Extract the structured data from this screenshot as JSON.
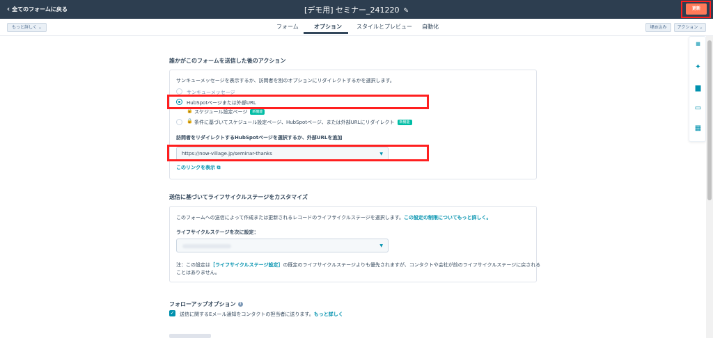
{
  "header": {
    "back_label": "全てのフォームに戻る",
    "form_title": "[デモ用] セミナー_241220",
    "update_label": "更新"
  },
  "subheader": {
    "more_label": "もっと詳しく ⌄",
    "tabs": [
      {
        "label": "フォーム"
      },
      {
        "label": "オプション"
      },
      {
        "label": "スタイルとプレビュー"
      },
      {
        "label": "自動化"
      }
    ],
    "embed_label": "埋め込み",
    "actions_label": "アクション ⌄"
  },
  "section_after_submit": {
    "title": "誰かがこのフォームを送信した後のアクション",
    "description": "サンキューメッセージを表示するか、訪問者を別のオプションにリダイレクトするかを選択します。",
    "options": [
      {
        "label": "サンキューメッセージ",
        "checked": false
      },
      {
        "label": "HubSpotページまたは外部URL",
        "checked": true
      },
      {
        "label": "スケジュール設定ページ",
        "checked": false,
        "badge": "新機能"
      },
      {
        "label": "条件に基づいてスケジュール設定ページ、HubSpotページ、または外部URLにリダイレクト",
        "checked": false,
        "badge": "新機能"
      }
    ],
    "redirect_label": "訪問者をリダイレクトするHubSpotページを選択するか、外部URLを追加",
    "redirect_value": "https://now-village.jp/seminar-thanks",
    "show_link": "このリンクを表示"
  },
  "section_lifecycle": {
    "title": "送信に基づいてライフサイクルステージをカスタマイズ",
    "description": "このフォームへの送信によって作成または更新されるレコードのライフサイクルステージを選択します。",
    "description_link": "この設定の制限についてもっと詳しく。",
    "field_label": "ライフサイクルステージを次に設定：",
    "note_prefix": "注：この設定は",
    "note_link": "［ライフサイクルステージ設定］",
    "note_suffix": "の既定のライフサイクルステージよりも優先されますが、コンタクトや会社が前のライフサイクルステージに戻される",
    "note_line2": "ことはありません。"
  },
  "section_followup": {
    "title": "フォローアップオプション",
    "checkbox_label": "送信に関するEメール通知をコンタクトの担当者に送ります。",
    "checkbox_link": "もっと詳しく",
    "checked": true
  },
  "colors": {
    "header_bg": "#2d3e50",
    "accent": "#0091ae",
    "update_button": "#ff7a59",
    "highlight": "#ff1f1f",
    "badge": "#00bda5"
  },
  "rail_icons": [
    "grid-icon",
    "sparkle-icon",
    "chat-icon",
    "window-icon",
    "calendar-icon"
  ]
}
